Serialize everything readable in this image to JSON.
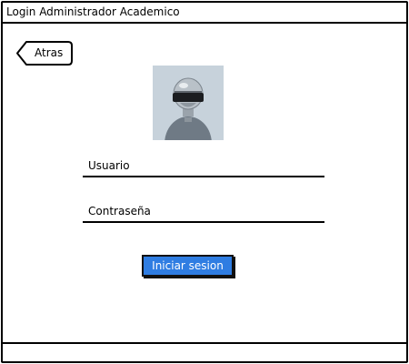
{
  "window": {
    "title": "Login Administrador Academico"
  },
  "nav": {
    "back_label": "Atras"
  },
  "form": {
    "username_label": "Usuario",
    "password_label": "Contraseña",
    "submit_label": "Iniciar sesion"
  },
  "colors": {
    "primary_button": "#2f7de2",
    "avatar_background": "#c7d2db",
    "avatar_body": "#6f7a85"
  },
  "icons": {
    "avatar": "robot-helmet-avatar-icon",
    "back": "left-arrow-tag-icon"
  }
}
